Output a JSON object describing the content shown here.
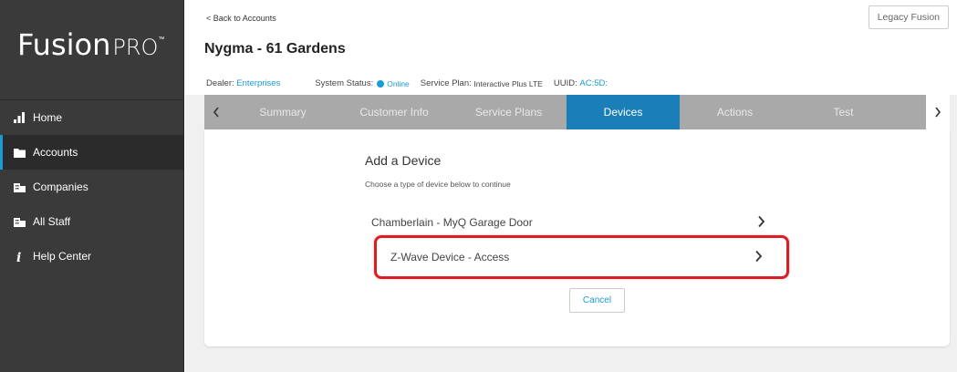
{
  "brand": {
    "word": "Fusion",
    "pro": "PRO",
    "tm": "™"
  },
  "sidebar": {
    "items": [
      {
        "label": "Home",
        "icon": "bar-chart-icon"
      },
      {
        "label": "Accounts",
        "icon": "folder-icon",
        "active": true
      },
      {
        "label": "Companies",
        "icon": "building-icon"
      },
      {
        "label": "All Staff",
        "icon": "people-icon"
      },
      {
        "label": "Help Center",
        "icon": "info-icon"
      }
    ]
  },
  "header": {
    "back_link": "< Back to Accounts",
    "legacy_button": "Legacy Fusion",
    "account_title": "Nygma - 61 Gardens",
    "dealer_label": "Dealer:",
    "dealer_value": "Enterprises",
    "status_label": "System Status:",
    "status_value": "Online",
    "plan_label": "Service Plan:",
    "plan_value": "Interactive Plus LTE",
    "uuid_label": "UUID:",
    "uuid_value": "AC:5D:"
  },
  "tabs": [
    {
      "label": "Summary"
    },
    {
      "label": "Customer Info"
    },
    {
      "label": "Service Plans"
    },
    {
      "label": "Devices",
      "active": true
    },
    {
      "label": "Actions"
    },
    {
      "label": "Test"
    }
  ],
  "card": {
    "title": "Add a Device",
    "subtitle": "Choose a type of device below to continue",
    "devices": [
      {
        "label": "Chamberlain - MyQ Garage Door"
      },
      {
        "label": "Z-Wave Device - Access",
        "highlighted": true
      }
    ],
    "cancel_label": "Cancel"
  },
  "colors": {
    "accent": "#1a9bd7",
    "active_tab": "#1a7fb8",
    "highlight": "#d91e26",
    "sidebar": "#3a3a3a"
  }
}
